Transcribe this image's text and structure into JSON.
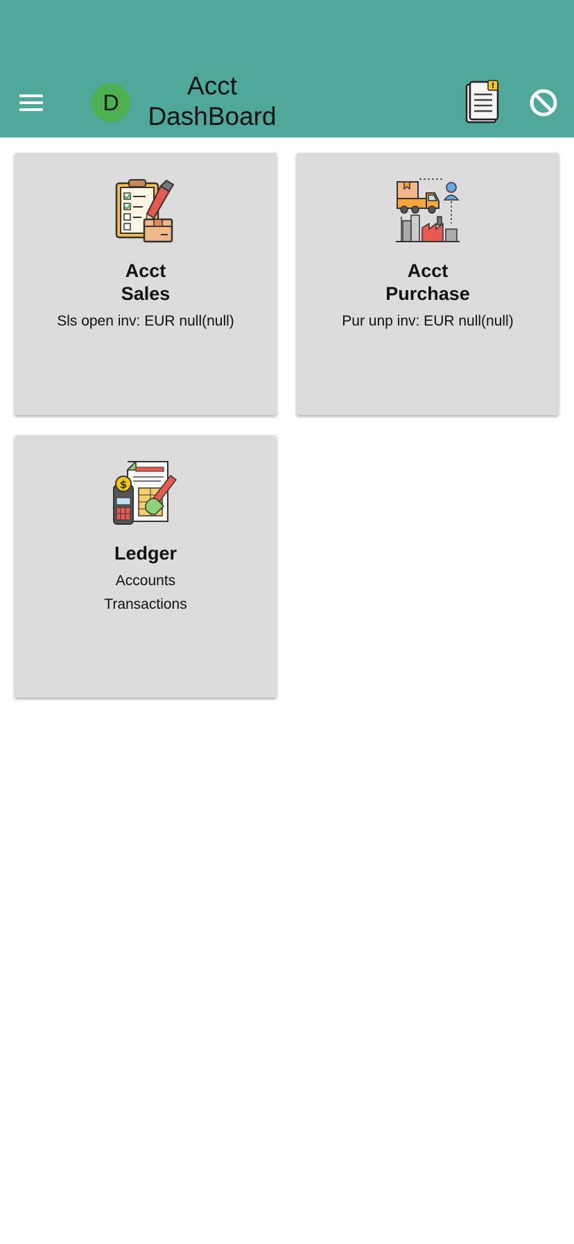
{
  "appbar": {
    "avatar_letter": "D",
    "title_line1": "Acct",
    "title_line2": "DashBoard"
  },
  "cards": [
    {
      "title_line1": "Acct",
      "title_line2": "Sales",
      "subtitle": "Sls open inv: EUR null(null)",
      "icon": "clipboard-checklist-icon"
    },
    {
      "title_line1": "Acct",
      "title_line2": "Purchase",
      "subtitle": "Pur unp inv: EUR null(null)",
      "icon": "supply-chain-truck-icon"
    },
    {
      "title_line1": "Ledger",
      "line1": "Accounts",
      "line2": "Transactions",
      "icon": "ledger-calculator-icon"
    }
  ],
  "colors": {
    "appbar": "#4ea99a",
    "avatar": "#4caf50",
    "card": "#dcdcdc"
  }
}
